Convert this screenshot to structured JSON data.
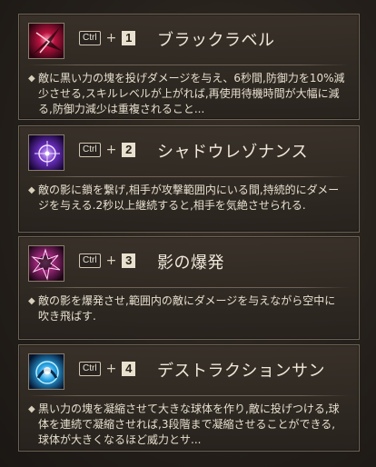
{
  "skills": [
    {
      "modifier": "Ctrl",
      "plus": "+",
      "number": "1",
      "name": "ブラックラベル",
      "icon": "dark-burst-icon",
      "description": "敵に黒い力の塊を投げダメージを与え、6秒間,防御力を10%減少させる,スキルレベルが上がれば,再使用待機時間が大幅に減る,防御力減少は重複されること..."
    },
    {
      "modifier": "Ctrl",
      "plus": "+",
      "number": "2",
      "name": "シャドウレゾナンス",
      "icon": "shadow-target-icon",
      "description": "敵の影に鎖を繋げ,相手が攻撃範囲内にいる間,持続的にダメージを与える.2秒以上継続すると,相手を気絶させられる."
    },
    {
      "modifier": "Ctrl",
      "plus": "+",
      "number": "3",
      "name": "影の爆発",
      "icon": "shadow-explosion-icon",
      "description": "敵の影を爆発させ,範囲内の敵にダメージを与えながら空中に吹き飛ばす."
    },
    {
      "modifier": "Ctrl",
      "plus": "+",
      "number": "4",
      "name": "デストラクションサン",
      "icon": "destruction-sun-icon",
      "description": "黒い力の塊を凝縮させて大きな球体を作り,敵に投げつける,球体を連続で凝縮させれば,3段階まで凝縮させることができる,球体が大きくなるほど威力とサ..."
    }
  ],
  "colors": {
    "panel_border": "#6d6356",
    "title_text": "#f0e9da",
    "body_text": "#e6dfcf"
  }
}
